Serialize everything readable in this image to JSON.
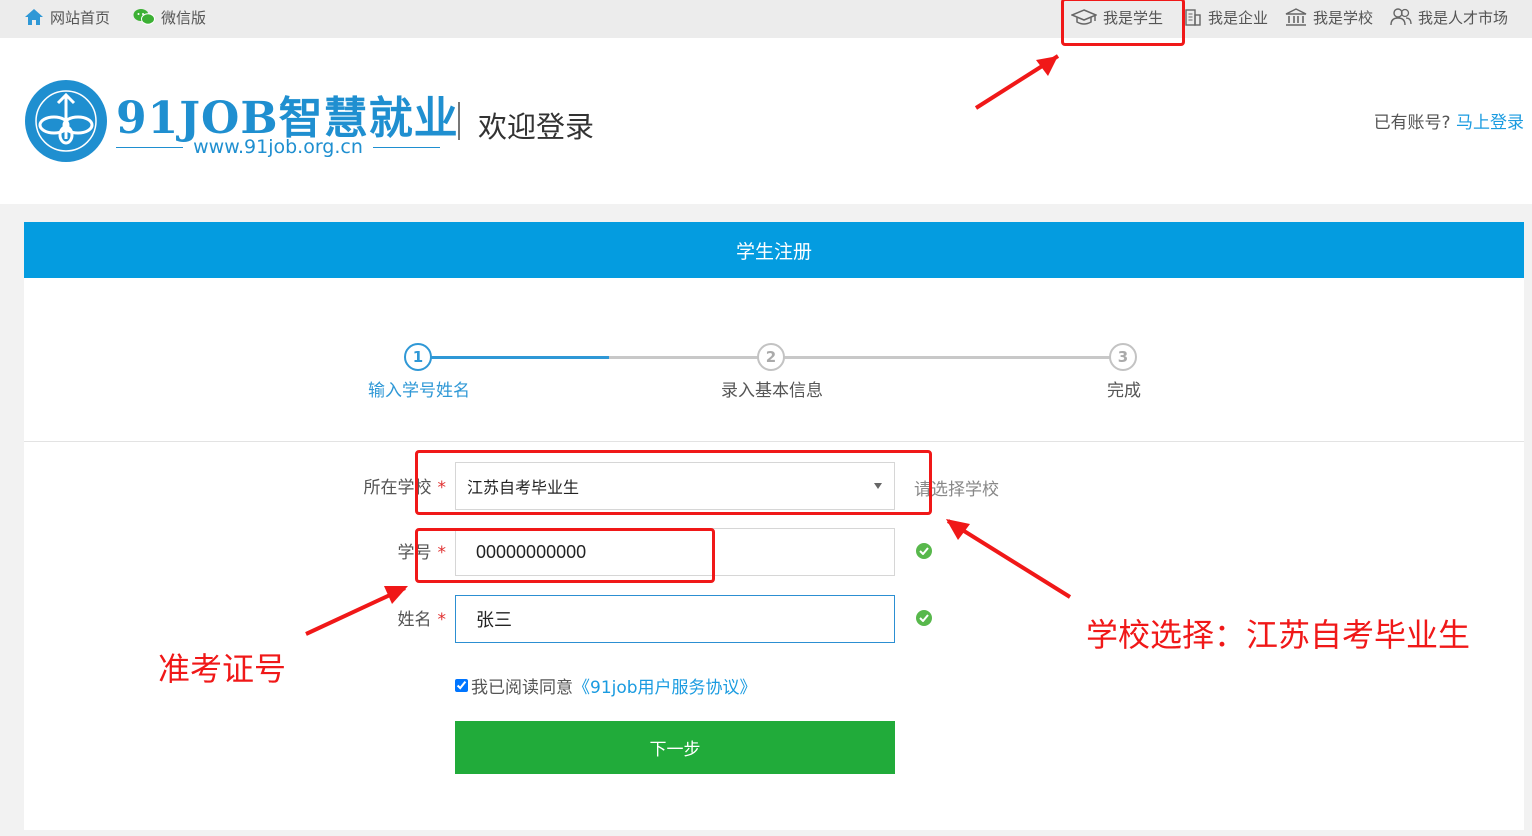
{
  "topbar": {
    "home": "网站首页",
    "wechat": "微信版",
    "student": "我是学生",
    "enterprise": "我是企业",
    "school": "我是学校",
    "talent_market": "我是人才市场"
  },
  "header": {
    "brand": "91JOB智慧就业",
    "url": "www.91job.org.cn",
    "welcome": "欢迎登录",
    "has_account": "已有账号?",
    "login_link": "马上登录"
  },
  "panel": {
    "title": "学生注册"
  },
  "steps": [
    {
      "number": "1",
      "label": "输入学号姓名",
      "active": true
    },
    {
      "number": "2",
      "label": "录入基本信息",
      "active": false
    },
    {
      "number": "3",
      "label": "完成",
      "active": false
    }
  ],
  "steps_progress": 0.27,
  "form": {
    "school_label": "所在学校",
    "school_value": "江苏自考毕业生",
    "school_hint": "请选择学校",
    "student_id_label": "学号",
    "student_id_value": "00000000000",
    "name_label": "姓名",
    "name_value": "张三",
    "required_mark": "*",
    "agree_text": "我已阅读同意",
    "agreement_link": "《91job用户服务协议》",
    "agree_checked": true,
    "next_button": "下一步"
  },
  "annotations": {
    "id_note": "准考证号",
    "school_note": "学校选择：江苏自考毕业生",
    "color": "#f01818"
  },
  "colors": {
    "brand_blue": "#049ce0",
    "link_blue": "#1a9be0",
    "next_green": "#21ab3a",
    "ok_green": "#58b84c"
  }
}
